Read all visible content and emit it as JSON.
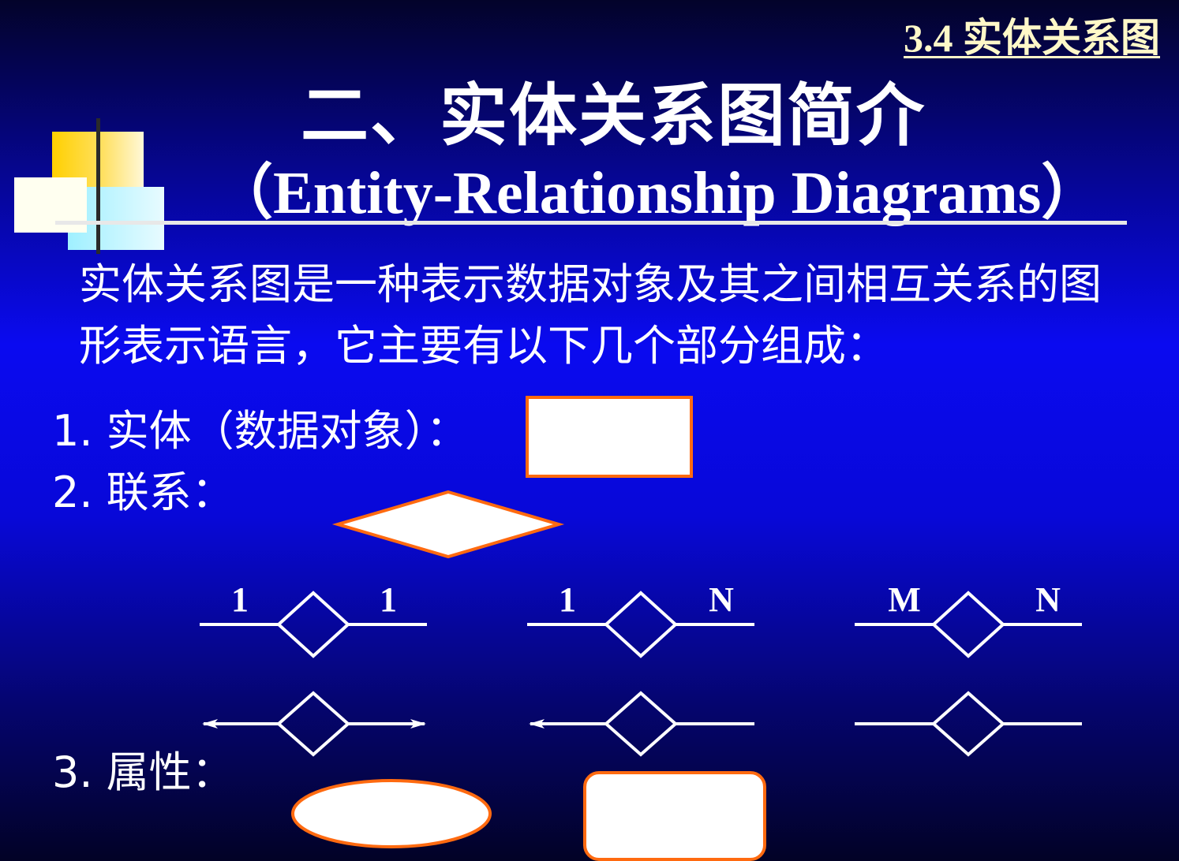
{
  "header": {
    "section_tag": "3.4 实体关系图",
    "title": "二、实体关系图简介",
    "subtitle": "（Entity-Relationship Diagrams）"
  },
  "intro": "实体关系图是一种表示数据对象及其之间相互关系的图形表示语言，它主要有以下几个部分组成：",
  "items": {
    "entity": "1. 实体（数据对象）：",
    "relationship": "2. 联系：",
    "attribute": "3. 属性："
  },
  "cardinality": {
    "one_to_one": [
      "1",
      "1"
    ],
    "one_to_many": [
      "1",
      "N"
    ],
    "many_to_many": [
      "M",
      "N"
    ]
  },
  "colors": {
    "shape_border": "#ff6a10",
    "accent_yellow": "#ffd000",
    "tag_color": "#fff8c8"
  }
}
